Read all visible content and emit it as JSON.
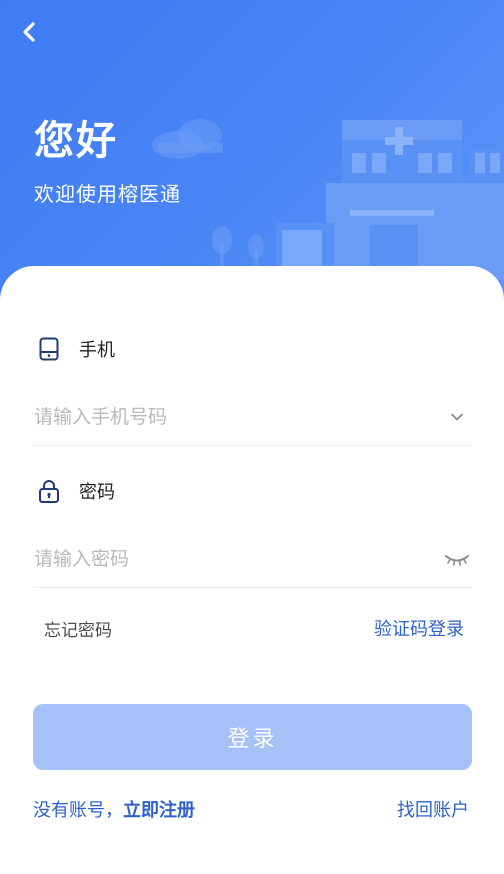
{
  "header": {
    "back_icon": "chevron-left-icon",
    "title": "您好",
    "subtitle": "欢迎使用榕医通",
    "background_color": "#4a86f6"
  },
  "form": {
    "phone": {
      "label": "手机",
      "icon": "phone-icon",
      "placeholder": "请输入手机号码",
      "value": "",
      "trailing_icon": "chevron-down-icon"
    },
    "password": {
      "label": "密码",
      "icon": "lock-icon",
      "placeholder": "请输入密码",
      "value": "",
      "trailing_icon": "eye-closed-icon"
    },
    "forgot_label": "忘记密码",
    "code_login_label": "验证码登录",
    "login_button_label": "登录"
  },
  "footer": {
    "no_account_text": "没有账号，",
    "register_label": "立即注册",
    "recover_label": "找回账户"
  },
  "colors": {
    "accent": "#2f62c9",
    "button_disabled": "#a5c1f8",
    "header_blue": "#4a86f6"
  }
}
